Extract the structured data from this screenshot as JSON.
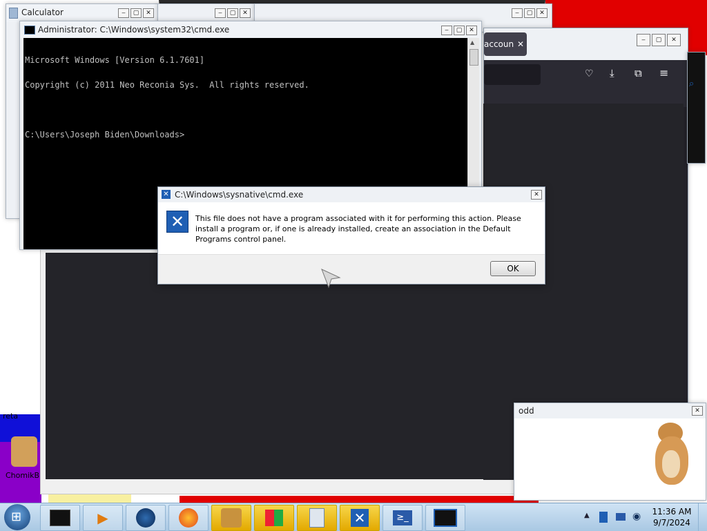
{
  "calculator": {
    "title": "Calculator"
  },
  "cmd": {
    "title": "Administrator: C:\\Windows\\system32\\cmd.exe",
    "lines": [
      "Microsoft Windows [Version 6.1.7601]",
      "Copyright (c) 2011 Neo Reconia Sys.  All rights reserved.",
      "",
      "C:\\Users\\Joseph Biden\\Downloads>"
    ]
  },
  "browser": {
    "tab_label": "accoun"
  },
  "dialog": {
    "title": "C:\\Windows\\sysnative\\cmd.exe",
    "message": "This file does not have a program associated with it for performing this action. Please install a program or, if one is already installed, create an association in the Default Programs control panel.",
    "ok_label": "OK"
  },
  "odd": {
    "title": "odd"
  },
  "desktop": {
    "icon_label": "ChomikB",
    "fragment_text": "reta"
  },
  "taskbar": {
    "items": [
      {
        "icon": "cmd-window-icon"
      },
      {
        "icon": "media-player-icon"
      },
      {
        "icon": "globe-icon"
      },
      {
        "icon": "firefox-icon"
      },
      {
        "icon": "chomik-box-icon"
      },
      {
        "icon": "blocks-icon"
      },
      {
        "icon": "calculator-icon"
      },
      {
        "icon": "error-x-icon"
      },
      {
        "icon": "powershell-icon"
      },
      {
        "icon": "console-icon"
      }
    ],
    "time": "11:36 AM",
    "date": "9/7/2024"
  },
  "colors": {
    "accent": "#1f5fb4",
    "console_bg": "#000000",
    "taskbar": "#b9d4ec"
  }
}
